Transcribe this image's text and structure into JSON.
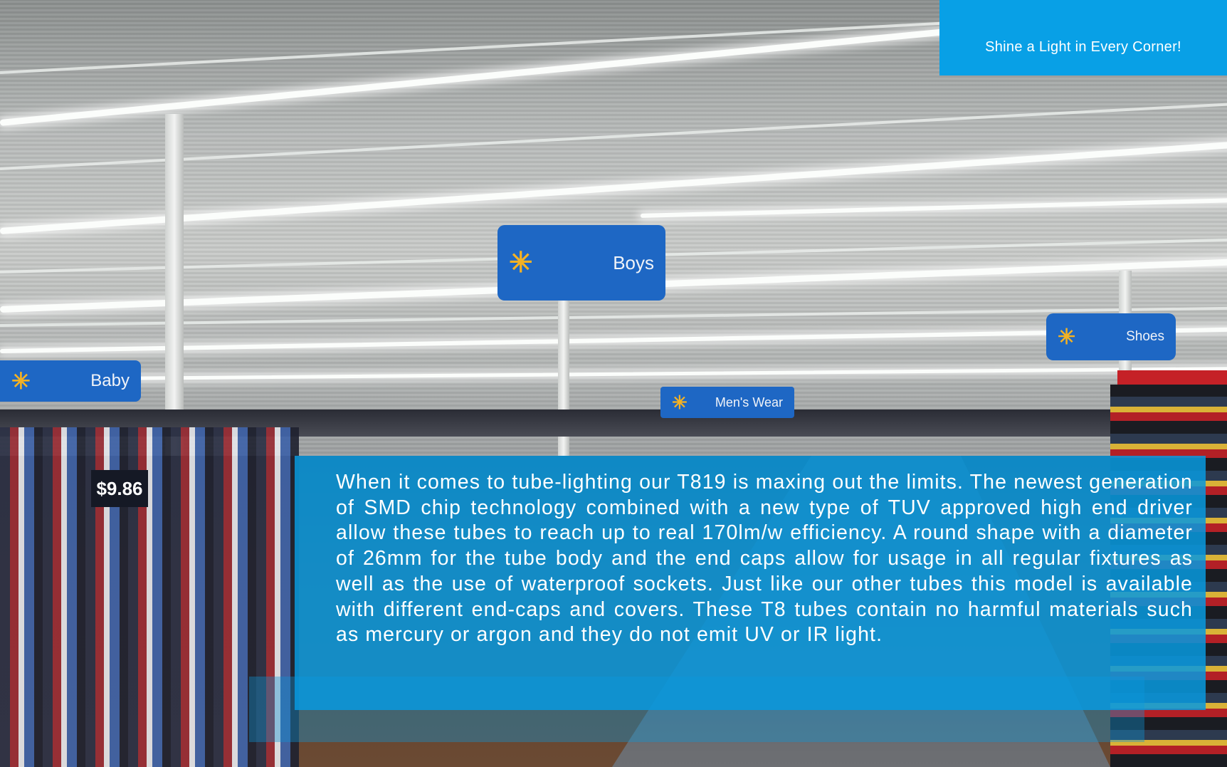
{
  "banner": {
    "tagline": "Shine a Light in Every Corner!"
  },
  "description": {
    "text": "When it comes to tube-lighting our T819 is maxing out the limits. The newest generation of SMD chip technology combined with a new type of TUV approved high end driver allow these tubes to reach up to real 170lm/w efficiency. A round shape with a diameter of 26mm for the tube body and the end caps allow for usage in all regular fixtures as well as the use of waterproof sockets. Just like our other tubes this model is available with different end-caps and covers. These T8 tubes contain no harmful materials such as mercury or argon and they do not emit UV or IR light."
  },
  "photo": {
    "signs": [
      "Boys",
      "Shoes",
      "Baby",
      "Men's Wear"
    ],
    "price": "$9.86",
    "sign_mark_icon": "spark-icon",
    "colors": {
      "accent": "#08a0e6",
      "sign_blue": "#1e67c4",
      "sign_mark": "#f4b223"
    }
  }
}
